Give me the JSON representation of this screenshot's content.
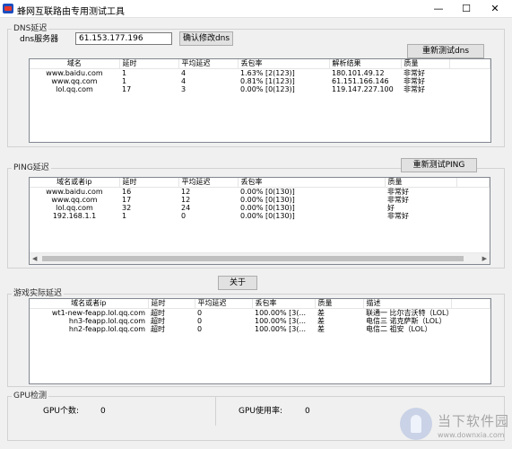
{
  "window": {
    "title": "蜂网互联路由专用测试工具",
    "min_glyph": "—",
    "max_glyph": "☐",
    "close_glyph": "✕"
  },
  "dns": {
    "group_title": "DNS延迟",
    "server_label": "dns服务器",
    "server_value": "61.153.177.196",
    "confirm_button": "确认修改dns",
    "retest_button": "重新测试dns",
    "columns": [
      "域名",
      "延时",
      "平均延迟",
      "丢包率",
      "解析结果",
      "质量"
    ],
    "rows": [
      [
        "www.baidu.com",
        "1",
        "4",
        "1.63%   [2(123)]",
        "180.101.49.12",
        "非常好"
      ],
      [
        "www.qq.com",
        "1",
        "4",
        "0.81%   [1(123)]",
        "61.151.166.146",
        "非常好"
      ],
      [
        "lol.qq.com",
        "17",
        "3",
        "0.00%   [0(123)]",
        "119.147.227.100",
        "非常好"
      ]
    ]
  },
  "ping": {
    "group_title": "PING延迟",
    "retest_button": "重新测试PING",
    "columns": [
      "域名或者ip",
      "延时",
      "平均延迟",
      "丢包率",
      "质量"
    ],
    "rows": [
      [
        "www.baidu.com",
        "16",
        "12",
        "0.00%   [0(130)]",
        "非常好"
      ],
      [
        "www.qq.com",
        "17",
        "12",
        "0.00%   [0(130)]",
        "非常好"
      ],
      [
        "lol.qq.com",
        "32",
        "24",
        "0.00%   [0(130)]",
        "好"
      ],
      [
        "192.168.1.1",
        "1",
        "0",
        "0.00%   [0(130)]",
        "非常好"
      ]
    ]
  },
  "about_button": "关于",
  "game": {
    "group_title": "游戏实际延迟",
    "columns": [
      "域名或者ip",
      "延时",
      "平均延迟",
      "丢包率",
      "质量",
      "描述"
    ],
    "rows": [
      [
        "wt1-new-feapp.lol.qq.com",
        "超时",
        "0",
        "100.00%   [3(...",
        "差",
        "联通一 比尔吉沃特（LOL）"
      ],
      [
        "hn3-feapp.lol.qq.com",
        "超时",
        "0",
        "100.00%   [3(...",
        "差",
        "电信三 诺克萨斯（LOL）"
      ],
      [
        "hn2-feapp.lol.qq.com",
        "超时",
        "0",
        "100.00%   [3(...",
        "差",
        "电信二 祖安（LOL）"
      ]
    ]
  },
  "gpu": {
    "group_title": "GPU检测",
    "count_label": "GPU个数:",
    "count_value": "0",
    "usage_label": "GPU使用率:",
    "usage_value": "0"
  },
  "watermark": {
    "cn": "当下软件园",
    "en": "www.downxia.com"
  }
}
